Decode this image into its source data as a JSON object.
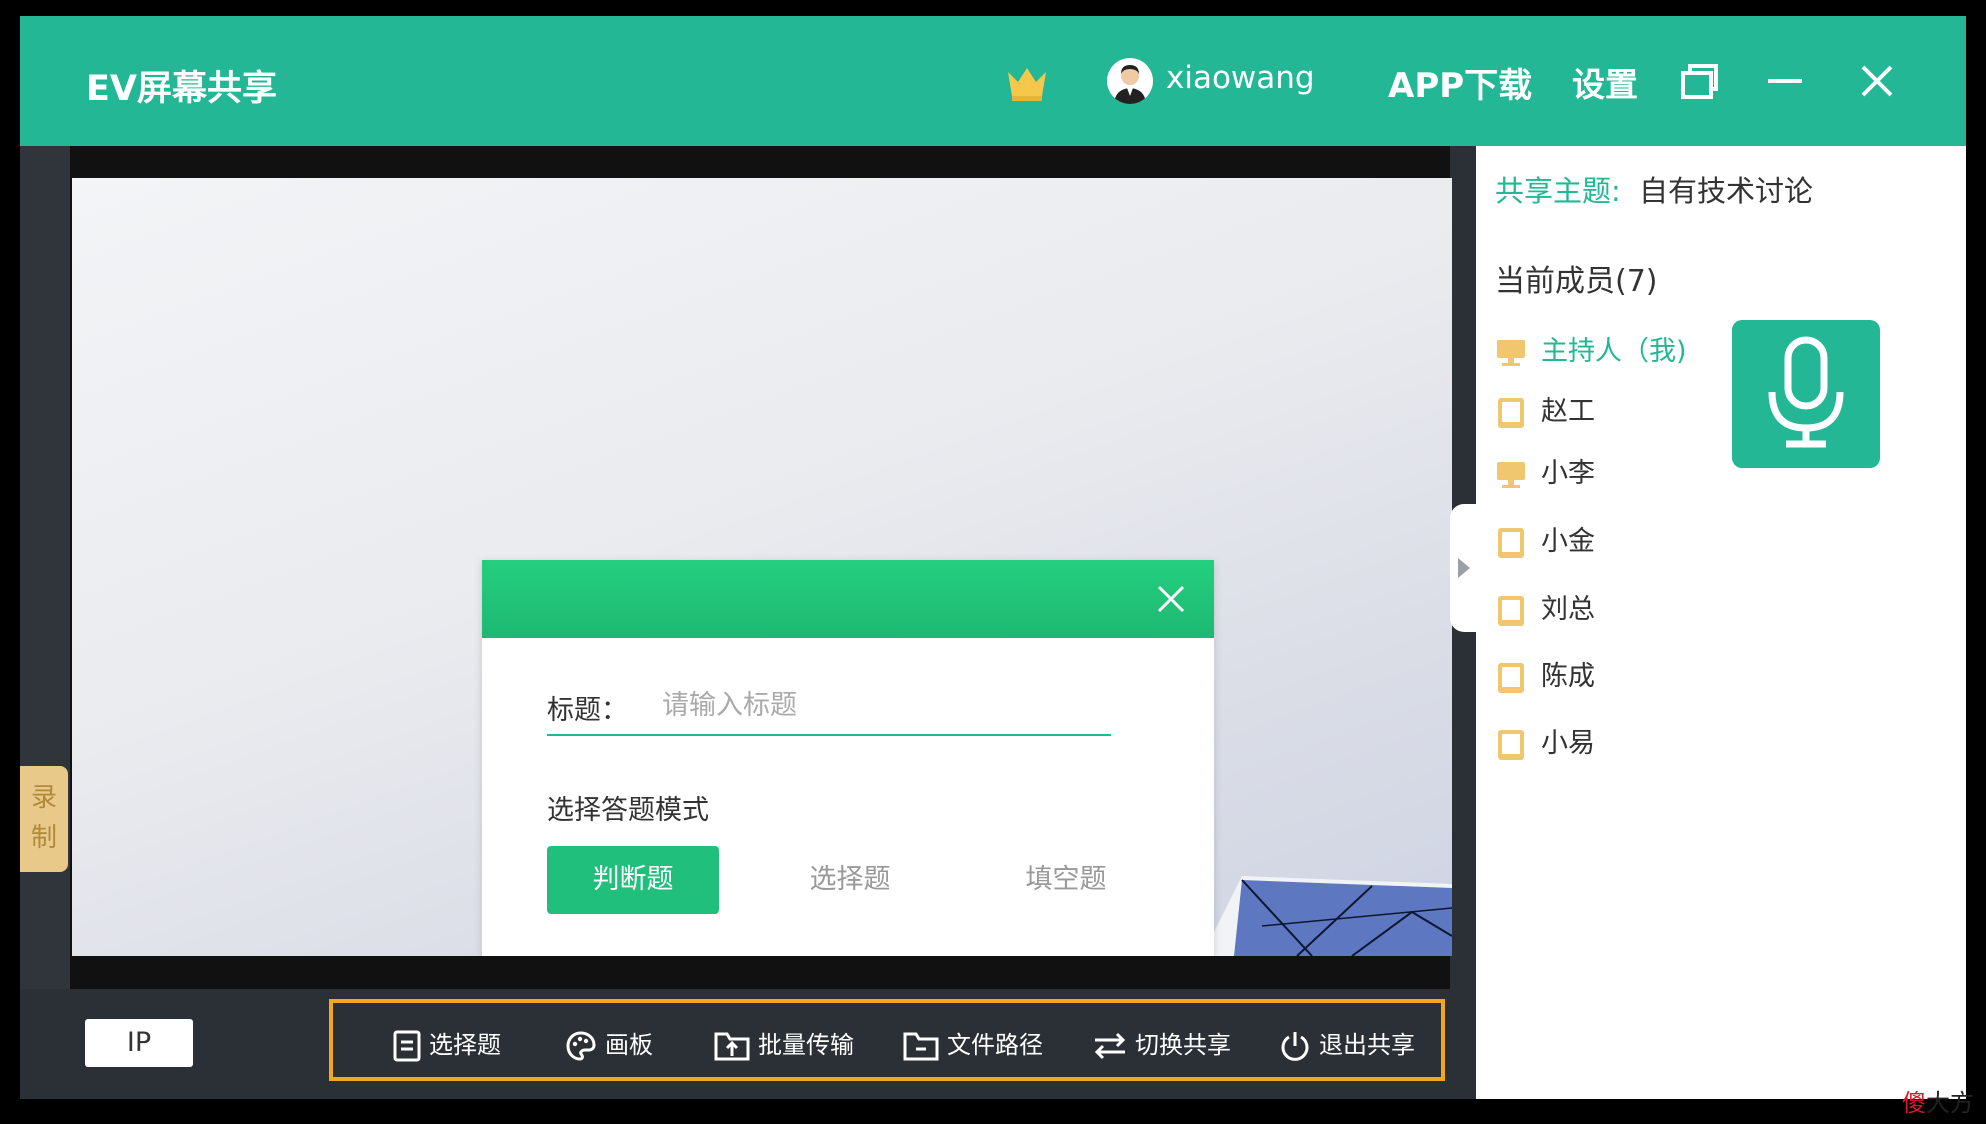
{
  "titlebar": {
    "app_title": "EV屏幕共享",
    "username": "xiaowang",
    "app_download": "APP下载",
    "settings": "设置",
    "icons": [
      "crown-icon",
      "user-avatar",
      "restore-icon",
      "minimize-icon",
      "close-icon"
    ]
  },
  "left": {
    "record_label_1": "录",
    "record_label_2": "制"
  },
  "dialog": {
    "title_label": "标题：",
    "title_placeholder": "请输入标题",
    "title_value": "",
    "mode_label": "选择答题模式",
    "modes": [
      "判断题",
      "选择题",
      "填空题"
    ],
    "selected_mode": "判断题"
  },
  "bottom": {
    "ip_label": "IP",
    "tools": [
      {
        "label": "选择题",
        "icon": "document-icon"
      },
      {
        "label": "画板",
        "icon": "palette-icon"
      },
      {
        "label": "批量传输",
        "icon": "upload-folder-icon"
      },
      {
        "label": "文件路径",
        "icon": "folder-icon"
      },
      {
        "label": "切换共享",
        "icon": "switch-arrows-icon"
      },
      {
        "label": "退出共享",
        "icon": "power-icon"
      }
    ]
  },
  "panel": {
    "topic_label": "共享主题:",
    "topic_value": "自有技术讨论",
    "members_title": "当前成员(7)",
    "members": [
      {
        "name": "主持人（我)",
        "device": "desktop",
        "host": true
      },
      {
        "name": "赵工",
        "device": "tablet"
      },
      {
        "name": "小李",
        "device": "desktop"
      },
      {
        "name": "小金",
        "device": "tablet"
      },
      {
        "name": "刘总",
        "device": "tablet"
      },
      {
        "name": "陈成",
        "device": "tablet"
      },
      {
        "name": "小易",
        "device": "tablet"
      }
    ]
  },
  "watermark": {
    "part1": "傻",
    "part2": "大方"
  },
  "colors": {
    "brand": "#23b795",
    "dialog_header": "#1fc478",
    "toolbar_highlight": "#f2a722",
    "device_icon": "#f0c66e"
  }
}
